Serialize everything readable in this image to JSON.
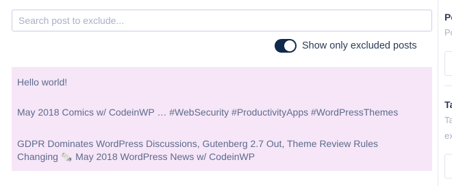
{
  "search": {
    "placeholder": "Search post to exclude..."
  },
  "filter": {
    "toggle_on": true,
    "label": "Show only excluded posts"
  },
  "posts": [
    {
      "title": "Hello world!"
    },
    {
      "title": "May 2018 Comics w/ CodeinWP … #WebSecurity #ProductivityApps #WordPressThemes"
    },
    {
      "title": "GDPR Dominates WordPress Discussions, Gutenberg 2.7 Out, Theme Review Rules Changing 🗞️ May 2018 WordPress News w/ CodeinWP"
    }
  ],
  "right_panel": {
    "title_1": "Po",
    "subtitle_1": "Po",
    "title_2": "Ta",
    "subtitle_2": "Ta",
    "subtitle_3": "ex"
  },
  "colors": {
    "list_background": "#f6e6f8",
    "toggle_active": "#102a4d",
    "text_muted": "#5d6b8c"
  }
}
